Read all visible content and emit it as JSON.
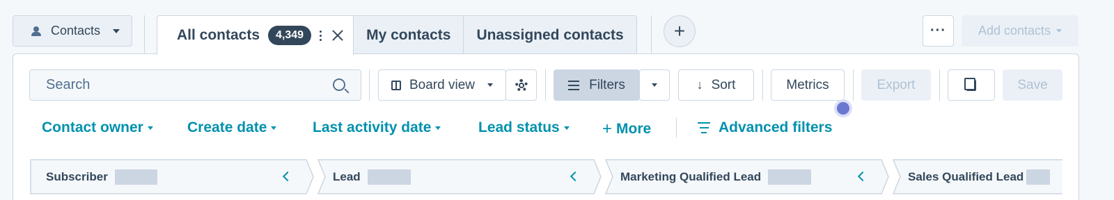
{
  "header": {
    "object_switcher": {
      "label": "Contacts",
      "icon": "person-icon"
    },
    "tabs": [
      {
        "label": "All contacts",
        "count": "4,349",
        "active": true
      },
      {
        "label": "My contacts",
        "active": false
      },
      {
        "label": "Unassigned contacts",
        "active": false
      }
    ],
    "add_tab_symbol": "+",
    "more_actions_symbol": "···",
    "add_contacts_label": "Add contacts"
  },
  "toolbar": {
    "search_placeholder": "Search",
    "board_view_label": "Board view",
    "filters_label": "Filters",
    "sort_label": "Sort",
    "sort_arrow": "↓",
    "metrics_label": "Metrics",
    "export_label": "Export",
    "save_label": "Save"
  },
  "quick_filters": {
    "contact_owner": "Contact owner",
    "create_date": "Create date",
    "last_activity_date": "Last activity date",
    "lead_status": "Lead status",
    "more": "More",
    "more_symbol": "+",
    "advanced_filters": "Advanced filters"
  },
  "board": {
    "columns": [
      {
        "label": "Subscriber"
      },
      {
        "label": "Lead"
      },
      {
        "label": "Marketing Qualified Lead"
      },
      {
        "label": "Sales Qualified Lead"
      }
    ]
  },
  "colors": {
    "accent": "#0091ae",
    "text": "#33475b",
    "border": "#cbd6e2",
    "indicator": "#6a78d1"
  }
}
